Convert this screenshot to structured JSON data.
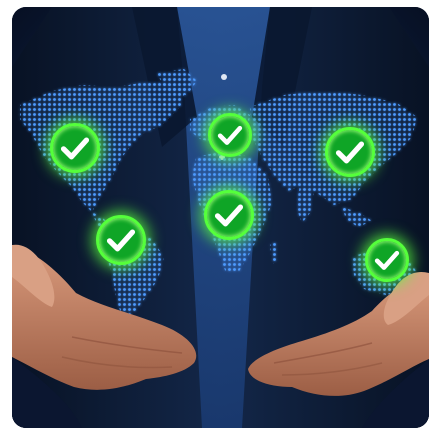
{
  "image": {
    "subject": "businessman-hands-presenting-world-map-with-checkmarks",
    "icon": "checkmark-badge-icon",
    "badge_count": 6,
    "colors": {
      "background": "#0b1630",
      "suit": "#0d1a33",
      "map_dots": "#3f8df0",
      "badge_fill": "#0fa526",
      "badge_ring": "#55ff3b",
      "skin": "#c9866a"
    }
  }
}
